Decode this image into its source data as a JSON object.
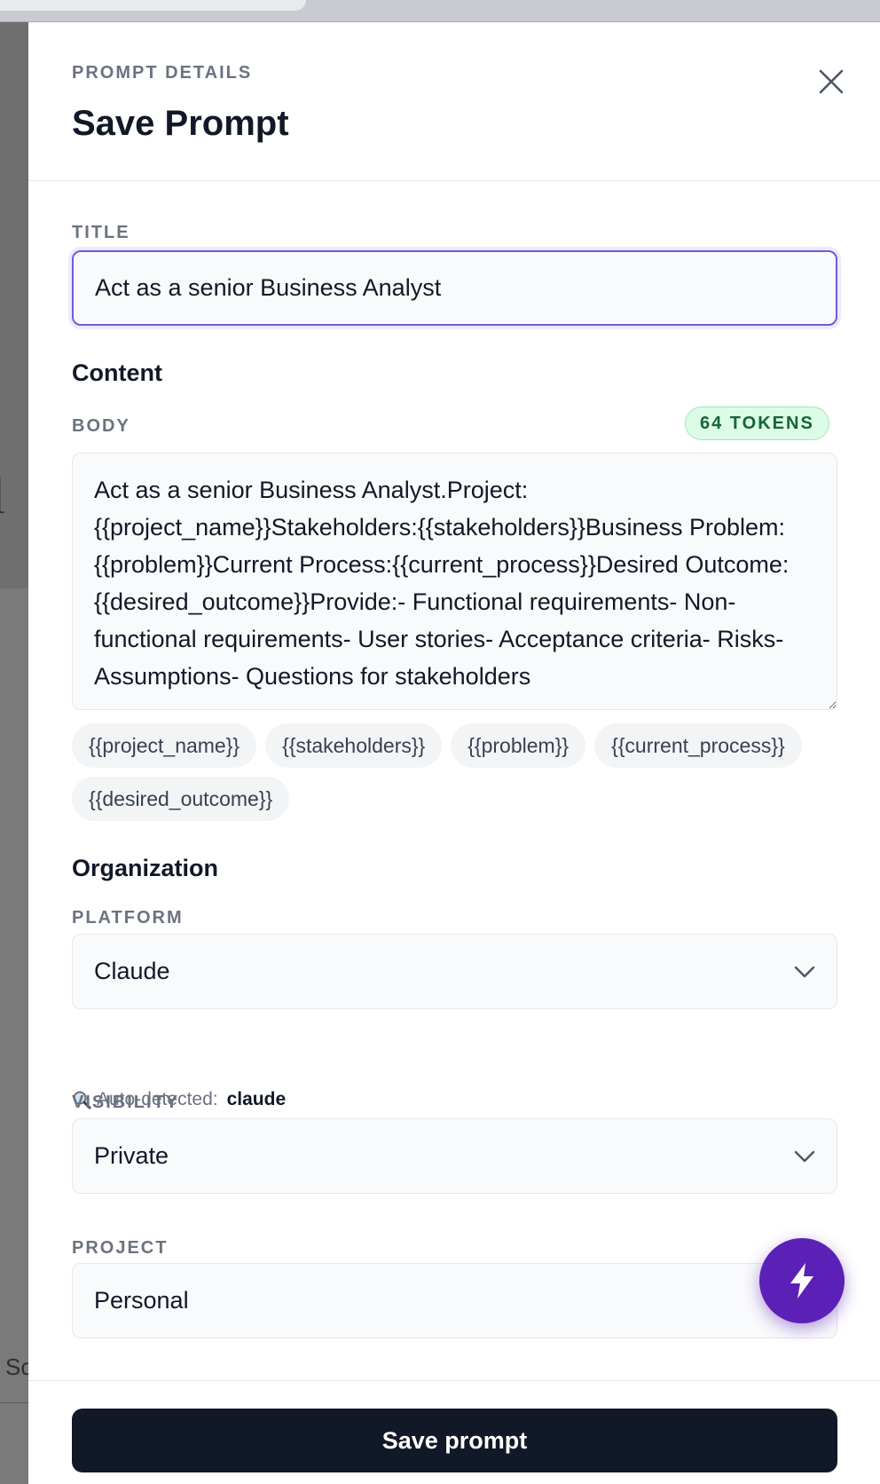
{
  "background": {
    "glyph": "l",
    "fragment": "Sc"
  },
  "header": {
    "eyebrow": "PROMPT DETAILS",
    "title": "Save Prompt"
  },
  "title_field": {
    "label": "TITLE",
    "value": "Act as a senior Business Analyst"
  },
  "content": {
    "section_title": "Content",
    "body_label": "BODY",
    "token_badge": "64 TOKENS",
    "body_value": "Act as a senior Business Analyst.Project:{{project_name}}Stakeholders:{{stakeholders}}Business Problem:{{problem}}Current Process:{{current_process}}Desired Outcome:{{desired_outcome}}Provide:- Functional requirements- Non-functional requirements- User stories- Acceptance criteria- Risks- Assumptions- Questions for stakeholders",
    "variables": [
      "{{project_name}}",
      "{{stakeholders}}",
      "{{problem}}",
      "{{current_process}}",
      "{{desired_outcome}}"
    ]
  },
  "organization": {
    "section_title": "Organization",
    "platform_label": "PLATFORM",
    "platform_value": "Claude",
    "autodetect_label": "Auto-detected:",
    "autodetect_value": "claude",
    "visibility_label": "VISIBILITY",
    "visibility_value": "Private",
    "project_label": "PROJECT",
    "project_value": "Personal"
  },
  "footer": {
    "save_label": "Save prompt"
  },
  "colors": {
    "accent": "#5b21b6",
    "focus_ring": "#6d5dd3",
    "token_bg": "#dcfce7",
    "token_text": "#166534",
    "primary_button": "#111827"
  },
  "icons": {
    "close": "close-icon",
    "chevron": "chevron-down-icon",
    "search": "magnifier-icon",
    "fab": "lightning-bolt-icon"
  }
}
